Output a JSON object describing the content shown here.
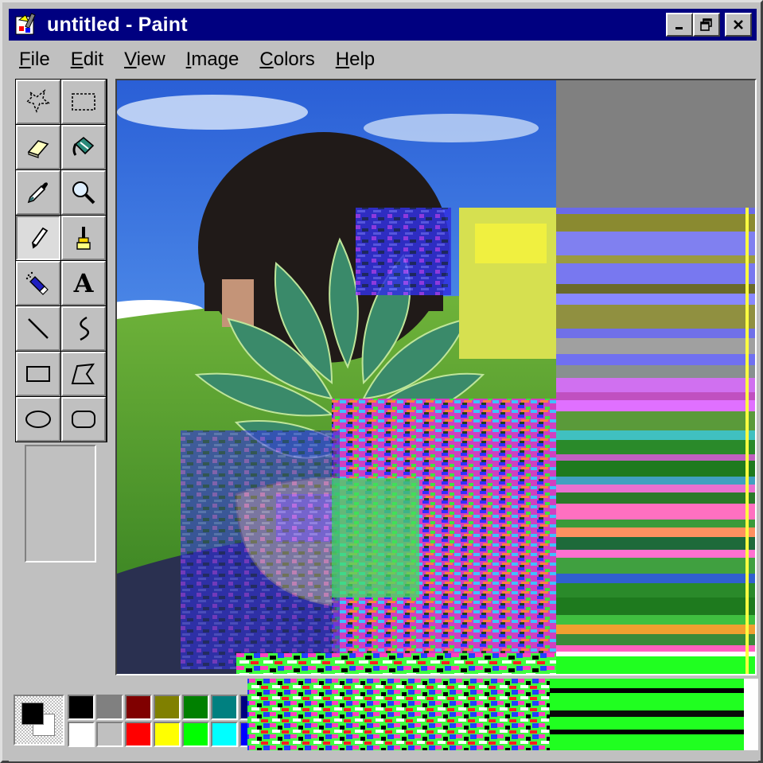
{
  "window": {
    "title": "untitled - Paint",
    "icon": "paint-app-icon",
    "title_bar_color": "#000080",
    "buttons": [
      "minimize-icon",
      "restore-icon",
      "close-icon"
    ]
  },
  "menu": {
    "items": [
      "File",
      "Edit",
      "View",
      "Image",
      "Colors",
      "Help"
    ]
  },
  "toolbox": {
    "tools": [
      {
        "icon": "free-form-select-icon"
      },
      {
        "icon": "rect-select-icon"
      },
      {
        "icon": "eraser-icon"
      },
      {
        "icon": "fill-bucket-icon"
      },
      {
        "icon": "eyedropper-icon"
      },
      {
        "icon": "magnifier-icon"
      },
      {
        "icon": "pencil-icon",
        "active": true
      },
      {
        "icon": "brush-icon"
      },
      {
        "icon": "airbrush-icon"
      },
      {
        "icon": "text-icon",
        "glyph": "A"
      },
      {
        "icon": "line-icon"
      },
      {
        "icon": "curve-icon"
      },
      {
        "icon": "rectangle-icon"
      },
      {
        "icon": "polygon-icon"
      },
      {
        "icon": "ellipse-icon"
      },
      {
        "icon": "rounded-rect-icon"
      }
    ]
  },
  "canvas": {
    "background": "#808080",
    "content": "glitched photo of a person with leaves over face, blue sky and green hill background"
  },
  "palette": {
    "foreground": "#000000",
    "background": "#ffffff",
    "row1": [
      "#000000",
      "#808080",
      "#800000",
      "#808000",
      "#008000",
      "#008080",
      "#000080",
      "#800080",
      "#808040",
      "#004040",
      "#0080ff",
      "#004080",
      "#8000ff",
      "#804000"
    ],
    "row2": [
      "#ffffff",
      "#c0c0c0",
      "#ff0000",
      "#ffff00",
      "#00ff00",
      "#00ffff",
      "#0000ff",
      "#ff00ff",
      "#ffff80",
      "#00ff80",
      "#80ffff",
      "#8080ff",
      "#ff0080",
      "#ff8040"
    ]
  }
}
